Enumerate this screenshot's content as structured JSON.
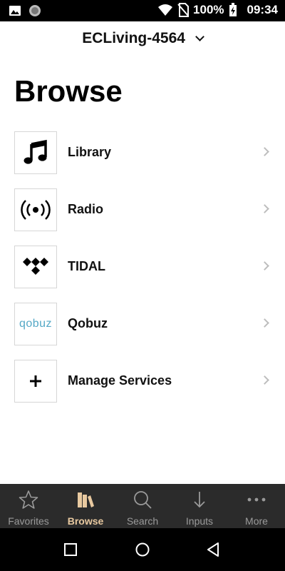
{
  "status_bar": {
    "battery": "100%",
    "time": "09:34"
  },
  "header": {
    "device_name": "ECLiving-4564"
  },
  "page": {
    "title": "Browse"
  },
  "browse_items": [
    {
      "label": "Library",
      "icon": "music-note-icon"
    },
    {
      "label": "Radio",
      "icon": "radio-broadcast-icon"
    },
    {
      "label": "TIDAL",
      "icon": "tidal-logo-icon"
    },
    {
      "label": "Qobuz",
      "icon": "qobuz-logo",
      "logo_text": "qobuz"
    },
    {
      "label": "Manage Services",
      "icon": "plus-icon"
    }
  ],
  "bottom_nav": {
    "items": [
      {
        "label": "Favorites",
        "icon": "star-icon"
      },
      {
        "label": "Browse",
        "icon": "books-icon",
        "active": true
      },
      {
        "label": "Search",
        "icon": "search-icon"
      },
      {
        "label": "Inputs",
        "icon": "arrow-down-icon"
      },
      {
        "label": "More",
        "icon": "more-dots-icon"
      }
    ]
  },
  "colors": {
    "active_tab": "#e8c9a0",
    "inactive_tab": "#9a9a9a",
    "nav_background": "#2b2b2b",
    "qobuz_brand": "#54a8c6"
  }
}
